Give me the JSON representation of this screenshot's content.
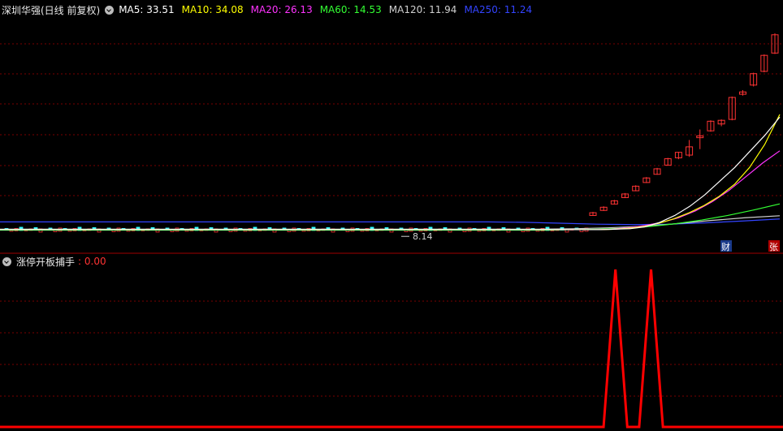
{
  "main_panel": {
    "title": "深圳华强(日线 前复权)",
    "ma": [
      {
        "label": "MA5: 33.51",
        "color": "#ffffff"
      },
      {
        "label": "MA10: 34.08",
        "color": "#ffff00"
      },
      {
        "label": "MA20: 26.13",
        "color": "#ff33ff"
      },
      {
        "label": "MA60: 14.53",
        "color": "#33ff33"
      },
      {
        "label": "MA120: 11.94",
        "color": "#cfcfcf"
      },
      {
        "label": "MA250: 11.24",
        "color": "#3344ff"
      }
    ],
    "low_marker": "8.14",
    "badge_cai": "财",
    "badge_zhang": "张"
  },
  "sub_panel": {
    "title": "涨停开板捕手",
    "value": ": 0.00"
  },
  "colors": {
    "up": "#ff3333",
    "down": "#33ffff",
    "grid": "#7a0000",
    "divider": "#a00000",
    "signal": "#ff0000"
  },
  "chart_data": [
    {
      "type": "candlestick",
      "title": "深圳华强(日线 前复权)",
      "series": [
        {
          "name": "MA5",
          "values": [
            8.9,
            8.9,
            9.0,
            9.1,
            9.5,
            10.5,
            12.0,
            14.0,
            16.5,
            19.5,
            22.5,
            26.0,
            29.5,
            33.51
          ]
        },
        {
          "name": "MA10",
          "values": [
            8.9,
            8.9,
            8.9,
            9.0,
            9.2,
            9.6,
            10.3,
            11.3,
            12.6,
            14.2,
            16.2,
            18.8,
            22.5,
            27.5,
            34.08
          ]
        },
        {
          "name": "MA20",
          "values": [
            8.9,
            8.9,
            8.9,
            9.0,
            9.3,
            9.8,
            10.5,
            11.5,
            13.0,
            15.0,
            17.5,
            20.5,
            23.5,
            26.13
          ]
        },
        {
          "name": "MA60",
          "values": [
            8.8,
            8.8,
            8.9,
            9.0,
            9.2,
            9.6,
            10.2,
            11.0,
            12.0,
            13.2,
            14.53
          ]
        },
        {
          "name": "MA120",
          "values": [
            9.0,
            9.0,
            9.1,
            9.3,
            9.6,
            10.2,
            10.9,
            11.5,
            11.94
          ]
        },
        {
          "name": "MA250",
          "values": [
            10.6,
            10.5,
            10.3,
            10.1,
            10.0,
            10.1,
            10.4,
            10.8,
            11.24
          ]
        }
      ],
      "candles": [
        {
          "o": 12.0,
          "c": 12.6,
          "h": 12.8,
          "l": 11.9
        },
        {
          "o": 13.1,
          "c": 13.8,
          "h": 14.0,
          "l": 13.0
        },
        {
          "o": 14.5,
          "c": 15.2,
          "h": 15.4,
          "l": 14.4
        },
        {
          "o": 15.9,
          "c": 16.7,
          "h": 16.9,
          "l": 15.8
        },
        {
          "o": 17.4,
          "c": 18.4,
          "h": 18.6,
          "l": 17.3
        },
        {
          "o": 19.2,
          "c": 20.2,
          "h": 20.4,
          "l": 19.1
        },
        {
          "o": 21.0,
          "c": 22.2,
          "h": 22.4,
          "l": 20.9
        },
        {
          "o": 23.0,
          "c": 24.4,
          "h": 24.6,
          "l": 22.9
        },
        {
          "o": 24.6,
          "c": 25.8,
          "h": 25.9,
          "l": 24.3
        },
        {
          "o": 25.2,
          "c": 27.0,
          "h": 28.5,
          "l": 24.8
        },
        {
          "o": 29.0,
          "c": 29.4,
          "h": 30.8,
          "l": 26.5
        },
        {
          "o": 30.5,
          "c": 32.6,
          "h": 32.8,
          "l": 30.3
        },
        {
          "o": 32.0,
          "c": 32.8,
          "h": 33.0,
          "l": 31.5
        },
        {
          "o": 33.0,
          "c": 37.8,
          "h": 38.0,
          "l": 32.8
        },
        {
          "o": 38.5,
          "c": 39.0,
          "h": 39.4,
          "l": 38.2
        },
        {
          "o": 40.5,
          "c": 43.0,
          "h": 43.2,
          "l": 40.2
        },
        {
          "o": 43.5,
          "c": 47.0,
          "h": 47.2,
          "l": 43.3
        },
        {
          "o": 47.5,
          "c": 51.5,
          "h": 51.8,
          "l": 47.3
        }
      ],
      "low_annotation": 8.14
    },
    {
      "type": "line",
      "title": "涨停开板捕手",
      "series": [
        {
          "name": "涨停开板捕手",
          "values": [
            0,
            0,
            0,
            0,
            0,
            0,
            1,
            0,
            0,
            1,
            0,
            0,
            0,
            0
          ]
        }
      ]
    }
  ]
}
